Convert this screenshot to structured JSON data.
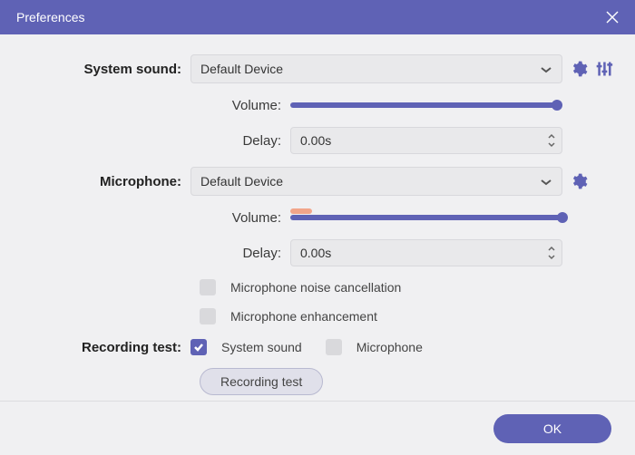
{
  "title": "Preferences",
  "sections": {
    "system_sound": {
      "label": "System sound:",
      "device": "Default Device",
      "volume_label": "Volume:",
      "volume_pct": 98,
      "delay_label": "Delay:",
      "delay_value": "0.00s"
    },
    "microphone": {
      "label": "Microphone:",
      "device": "Default Device",
      "volume_label": "Volume:",
      "volume_pct": 100,
      "volume_fill_pct": 8,
      "delay_label": "Delay:",
      "delay_value": "0.00s",
      "noise_cancel": "Microphone noise cancellation",
      "enhancement": "Microphone enhancement"
    },
    "recording_test": {
      "label": "Recording test:",
      "system_sound": "System sound",
      "microphone": "Microphone",
      "button": "Recording test"
    }
  },
  "footer": {
    "ok": "OK"
  },
  "colors": {
    "accent": "#5f62b5",
    "track_empty": "#c8c9d6",
    "mic_fill": "#f2a58a"
  }
}
